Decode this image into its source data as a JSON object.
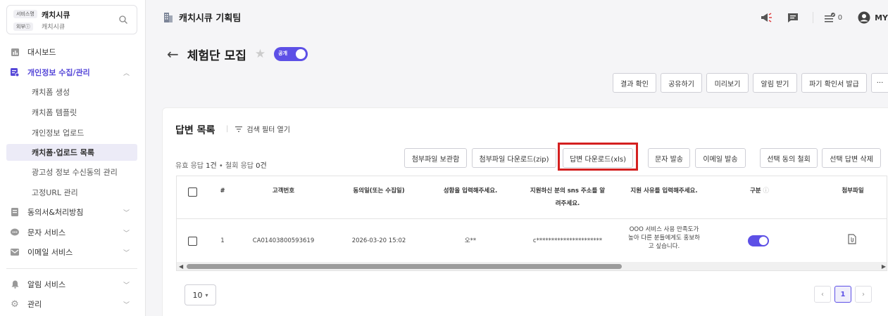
{
  "sidebar": {
    "service_tag": "서비스명",
    "service_name": "캐치시큐",
    "ext_tag": "외부ⓘ",
    "ext_name": "캐치시큐",
    "nav": [
      {
        "label": "대시보드",
        "icon": "chart-icon"
      },
      {
        "label": "개인정보 수집/관리",
        "icon": "personal-info-icon",
        "expanded": true
      },
      {
        "label": "동의서&처리방침",
        "icon": "document-icon"
      },
      {
        "label": "문자 서비스",
        "icon": "chat-bubble-icon"
      },
      {
        "label": "이메일 서비스",
        "icon": "mail-icon"
      },
      {
        "label": "알림 서비스",
        "icon": "bell-icon"
      },
      {
        "label": "관리",
        "icon": "gear-icon"
      }
    ],
    "sub_items": [
      "캐치폼 생성",
      "캐치폼 템플릿",
      "개인정보 업로드",
      "캐치폼·업로드 목록",
      "광고성 정보 수신동의 관리",
      "고정URL 관리"
    ],
    "selected_sub": "캐치폼·업로드 목록"
  },
  "header": {
    "team_name": "캐치시큐 기획팀",
    "notice_count": "0",
    "user_label": "MY"
  },
  "page": {
    "back_icon": "arrow-left-icon",
    "title": "체험단 모집",
    "public_label": "공개",
    "actions": [
      "결과 확인",
      "공유하기",
      "미리보기",
      "알림 받기",
      "파기 확인서 발급",
      "···"
    ]
  },
  "answers": {
    "title": "답변 목록",
    "filter_label": "검색 필터 열기",
    "stat_valid_label": "유효 응답 ",
    "stat_valid_count": "1건",
    "stat_sep": " • ",
    "stat_withdraw_label": "철회 응답 ",
    "stat_withdraw_count": "0건",
    "buttons": [
      "첨부파일 보관함",
      "첨부파일 다운로드(zip)",
      "답변 다운로드(xls)",
      "문자 발송",
      "이메일 발송",
      "선택 동의 철회",
      "선택 답변 삭제"
    ],
    "highlighted_button": "답변 다운로드(xls)",
    "columns": {
      "num": "#",
      "customer": "고객번호",
      "date": "동의일(또는 수집일)",
      "name": "성함을 입력해주세요.",
      "sns_line1": "지원하신 분의 sns 주소를 알",
      "sns_line2": "려주세요.",
      "reason": "지원 사유를 입력해주세요.",
      "type": "구분",
      "attachment": "첨부파일"
    },
    "rows": [
      {
        "num": "1",
        "customer": "CA01403800593619",
        "date": "2026-03-20 15:02",
        "name": "오**",
        "sns": "c**********************",
        "reason_line1": "OOO 서비스 사용 만족도가",
        "reason_line2": "높아 다른 분들에게도 홍보하",
        "reason_line3": "고 싶습니다.",
        "consent_on": true
      }
    ],
    "page_size": "10",
    "current_page": "1"
  },
  "colors": {
    "accent": "#5d50e6",
    "highlight_border": "#d42020"
  }
}
